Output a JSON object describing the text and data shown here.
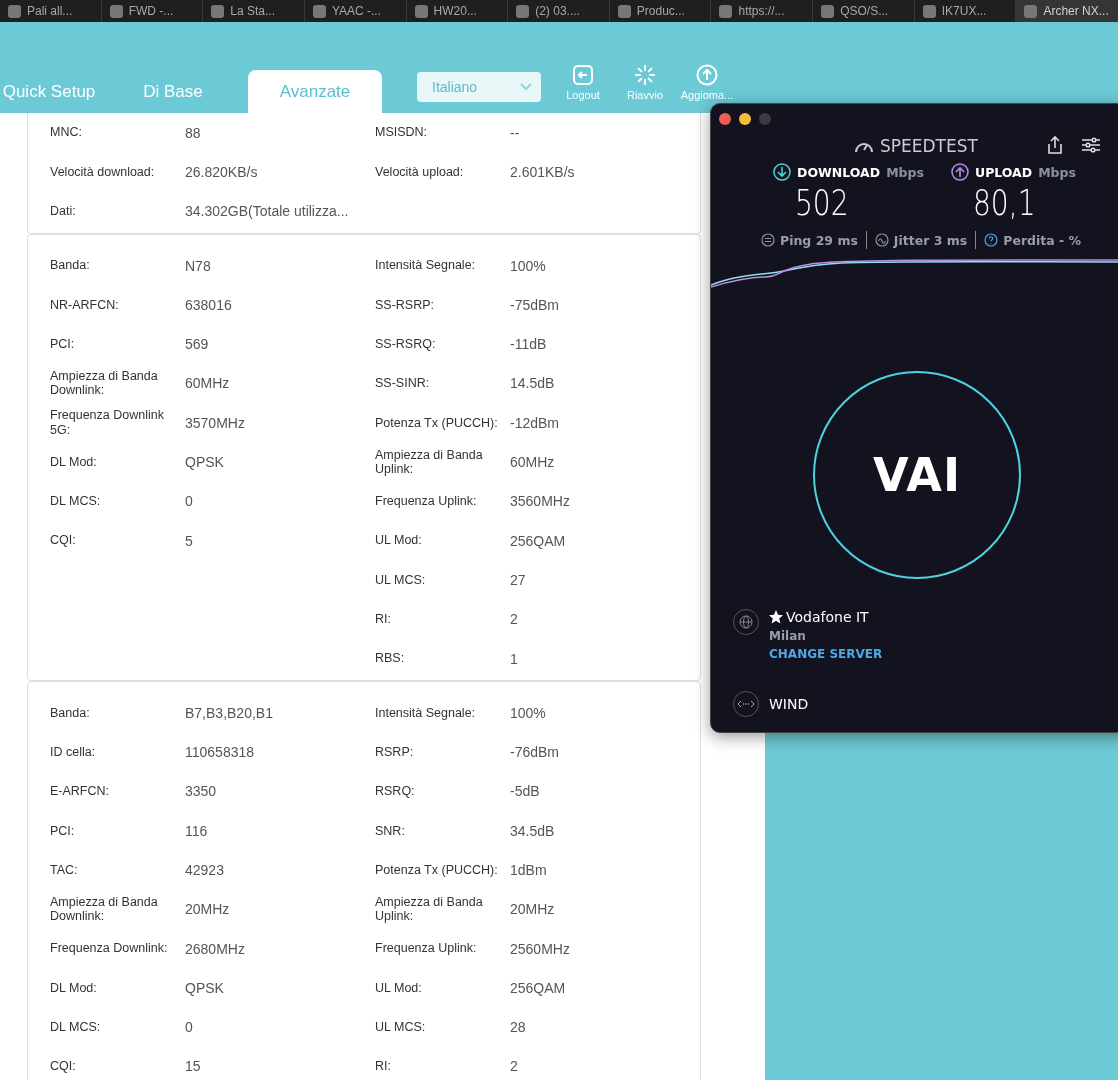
{
  "browser_tabs": [
    {
      "label": "Pali all...",
      "selected": false
    },
    {
      "label": "FWD -...",
      "selected": false
    },
    {
      "label": "La Sta...",
      "selected": false
    },
    {
      "label": "YAAC -...",
      "selected": false
    },
    {
      "label": "HW20...",
      "selected": false
    },
    {
      "label": "(2) 03....",
      "selected": false
    },
    {
      "label": "Produc...",
      "selected": false
    },
    {
      "label": "https://...",
      "selected": false
    },
    {
      "label": "QSO/S...",
      "selected": false
    },
    {
      "label": "IK7UX...",
      "selected": false
    },
    {
      "label": "Archer NX...",
      "selected": true
    }
  ],
  "nav_tabs": [
    {
      "label": "Quick Setup",
      "selected": false
    },
    {
      "label": "Di Base",
      "selected": false
    },
    {
      "label": "Avanzate",
      "selected": true
    }
  ],
  "language_select": {
    "value": "Italiano"
  },
  "header_actions": [
    {
      "kind": "logout",
      "label": "Logout"
    },
    {
      "kind": "reboot",
      "label": "Riavvio"
    },
    {
      "kind": "update",
      "label": "Aggioma..."
    }
  ],
  "sections": [
    {
      "rows": [
        {
          "left": {
            "label": "MNC:",
            "value": "88"
          },
          "right": {
            "label": "MSISDN:",
            "value": "--"
          }
        },
        {
          "left": {
            "label": "Velocità download:",
            "value": "26.820KB/s"
          },
          "right": {
            "label": "Velocità upload:",
            "value": "2.601KB/s"
          }
        },
        {
          "left": {
            "label": "Dati:",
            "value": "34.302GB(Totale utilizza..."
          }
        }
      ]
    },
    {
      "rows": [
        {
          "left": {
            "label": "Banda:",
            "value": "N78"
          },
          "right": {
            "label": "Intensità Segnale:",
            "value": "100%"
          }
        },
        {
          "left": {
            "label": "NR-ARFCN:",
            "value": "638016"
          },
          "right": {
            "label": "SS-RSRP:",
            "value": "-75dBm"
          }
        },
        {
          "left": {
            "label": "PCI:",
            "value": "569"
          },
          "right": {
            "label": "SS-RSRQ:",
            "value": "-11dB"
          }
        },
        {
          "left": {
            "label": "Ampiezza di Banda Downlink:",
            "value": "60MHz"
          },
          "right": {
            "label": "SS-SINR:",
            "value": "14.5dB"
          }
        },
        {
          "left": {
            "label": "Frequenza Downlink 5G:",
            "value": "3570MHz"
          },
          "right": {
            "label": "Potenza Tx (PUCCH):",
            "value": "-12dBm"
          }
        },
        {
          "left": {
            "label": "DL Mod:",
            "value": "QPSK"
          },
          "right": {
            "label": "Ampiezza di Banda Uplink:",
            "value": "60MHz"
          }
        },
        {
          "left": {
            "label": "DL MCS:",
            "value": "0"
          },
          "right": {
            "label": "Frequenza Uplink:",
            "value": "3560MHz"
          }
        },
        {
          "left": {
            "label": "CQI:",
            "value": "5"
          },
          "right": {
            "label": "UL Mod:",
            "value": "256QAM"
          }
        },
        {
          "right": {
            "label": "UL MCS:",
            "value": "27"
          }
        },
        {
          "right": {
            "label": "RI:",
            "value": "2"
          }
        },
        {
          "right": {
            "label": "RBS:",
            "value": "1"
          }
        }
      ]
    },
    {
      "rows": [
        {
          "left": {
            "label": "Banda:",
            "value": "B7,B3,B20,B1"
          },
          "right": {
            "label": "Intensità Segnale:",
            "value": "100%"
          }
        },
        {
          "left": {
            "label": "ID cella:",
            "value": "110658318"
          },
          "right": {
            "label": "RSRP:",
            "value": "-76dBm"
          }
        },
        {
          "left": {
            "label": "E-ARFCN:",
            "value": "3350"
          },
          "right": {
            "label": "RSRQ:",
            "value": "-5dB"
          }
        },
        {
          "left": {
            "label": "PCI:",
            "value": "116"
          },
          "right": {
            "label": "SNR:",
            "value": "34.5dB"
          }
        },
        {
          "left": {
            "label": "TAC:",
            "value": "42923"
          },
          "right": {
            "label": "Potenza Tx (PUCCH):",
            "value": "1dBm"
          }
        },
        {
          "left": {
            "label": "Ampiezza di Banda Downlink:",
            "value": "20MHz"
          },
          "right": {
            "label": "Ampiezza di Banda Uplink:",
            "value": "20MHz"
          }
        },
        {
          "left": {
            "label": "Frequenza Downlink:",
            "value": "2680MHz"
          },
          "right": {
            "label": "Frequenza Uplink:",
            "value": "2560MHz"
          }
        },
        {
          "left": {
            "label": "DL Mod:",
            "value": "QPSK"
          },
          "right": {
            "label": "UL Mod:",
            "value": "256QAM"
          }
        },
        {
          "left": {
            "label": "DL MCS:",
            "value": "0"
          },
          "right": {
            "label": "UL MCS:",
            "value": "28"
          }
        },
        {
          "left": {
            "label": "CQI:",
            "value": "15"
          },
          "right": {
            "label": "RI:",
            "value": "2"
          }
        }
      ]
    }
  ],
  "speedtest": {
    "logo": "SPEEDTEST",
    "download": {
      "label": "DOWNLOAD",
      "unit": "Mbps",
      "value": "502"
    },
    "upload": {
      "label": "UPLOAD",
      "unit": "Mbps",
      "value": "80,1"
    },
    "stats": [
      {
        "kind": "ping",
        "text": "Ping 29 ms"
      },
      {
        "kind": "jitter",
        "text": "Jitter 3 ms"
      },
      {
        "kind": "loss",
        "text": "Perdita - %"
      }
    ],
    "go_button": "VAI",
    "server": {
      "name": "Vodafone IT",
      "city": "Milan",
      "change": "CHANGE SERVER"
    },
    "provider": "WIND"
  }
}
